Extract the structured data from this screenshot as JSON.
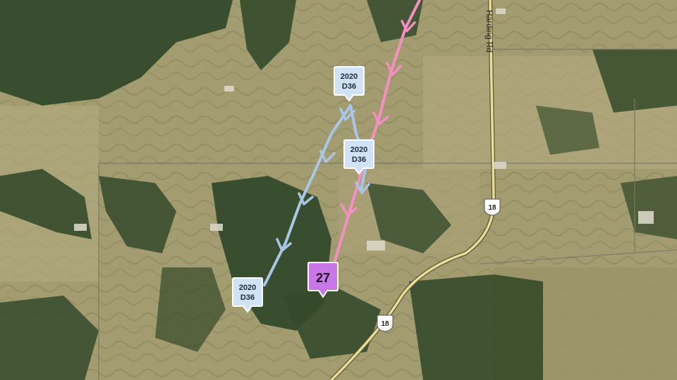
{
  "map": {
    "road_labels": {
      "harding_rd": "Harding Rd"
    },
    "highway_shields": {
      "top": "18",
      "bottom": "18"
    },
    "markers": {
      "blue_top": {
        "line1": "2020",
        "line2": "D36"
      },
      "blue_mid": {
        "line1": "2020",
        "line2": "D36"
      },
      "blue_bottom": {
        "line1": "2020",
        "line2": "D36"
      },
      "purple": {
        "label": "27"
      }
    },
    "colors": {
      "pink_track": "#f48fc2",
      "blue_track": "#a9c6e8",
      "purple_marker": "#c977e6",
      "blue_marker": "#cfe2f6",
      "road": "#e9dd98",
      "forest": "#344a2a",
      "field": "#a39c70"
    }
  }
}
